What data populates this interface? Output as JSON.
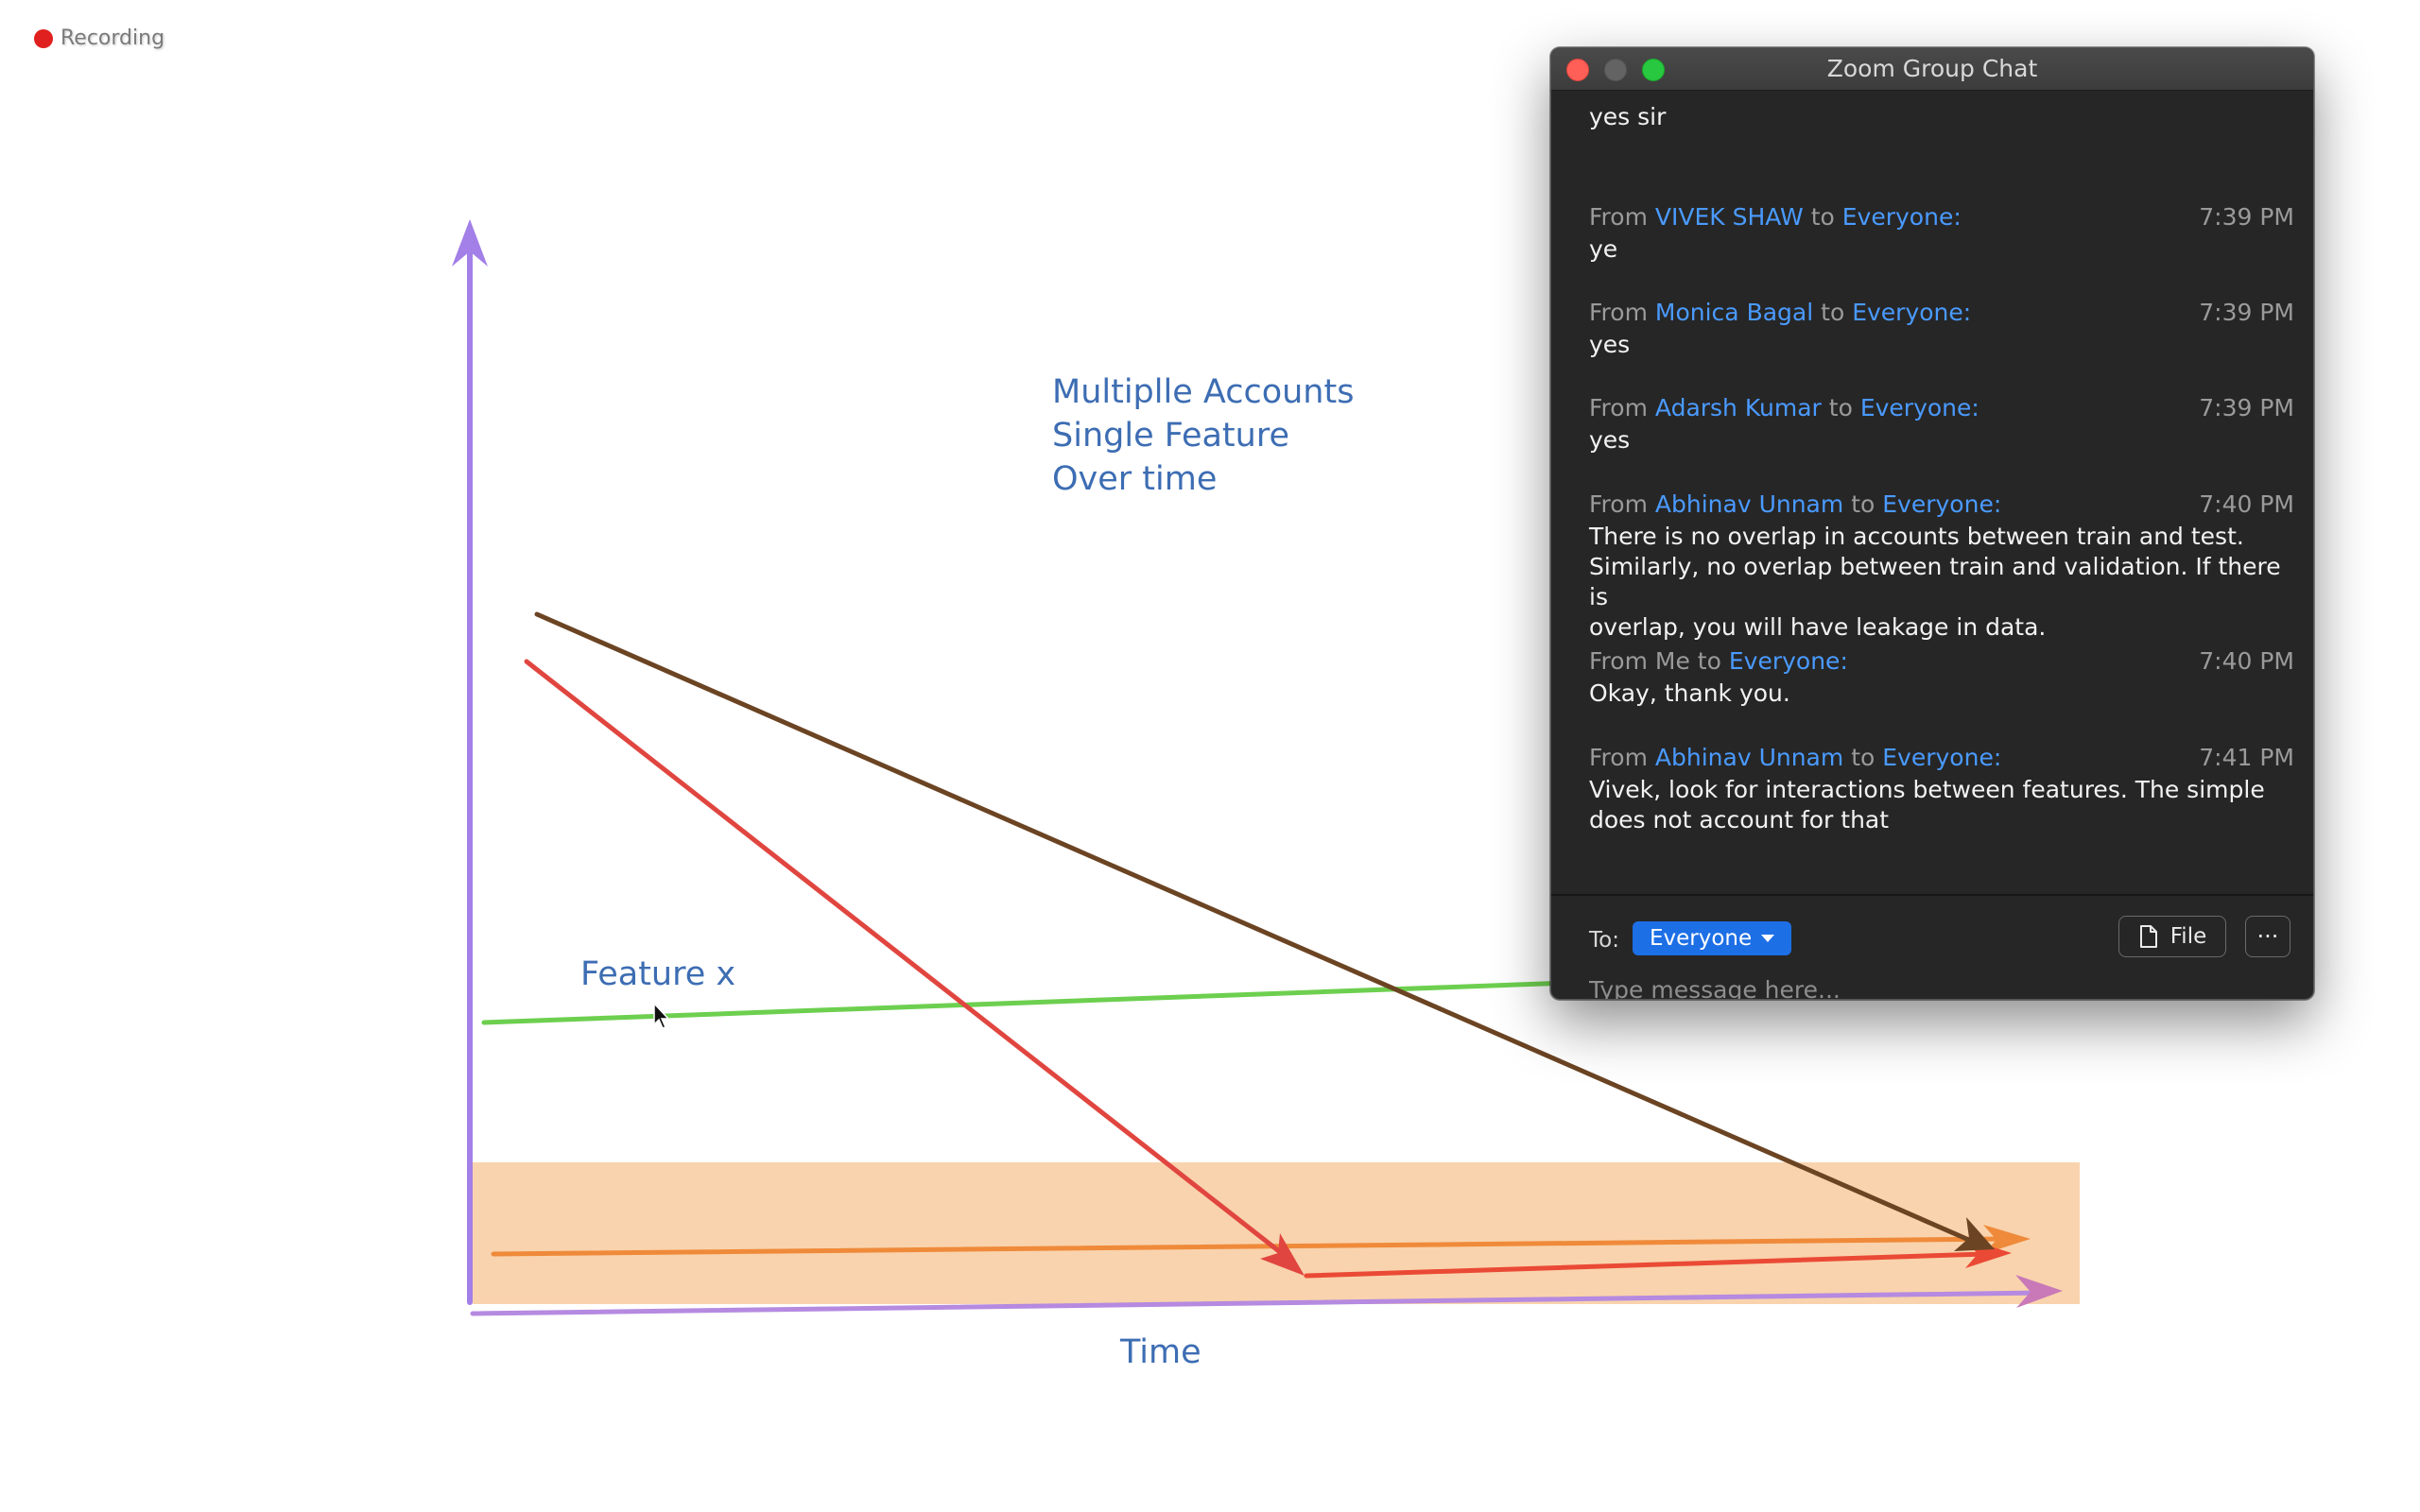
{
  "recording": {
    "label": "Recording"
  },
  "whiteboard": {
    "title_lines": [
      "Multiplle Accounts",
      "Single Feature",
      "Over time"
    ],
    "feature_label": "Feature x",
    "x_axis_label": "Time",
    "colors": {
      "axis": "#a37fe8",
      "band": "#f9d3ad",
      "green_line": "#6dcf4f",
      "brown_line": "#6b4423",
      "red_line": "#e0463f",
      "orange_line": "#ef8a3a",
      "text": "#3d6db3"
    }
  },
  "chat": {
    "title": "Zoom Group Chat",
    "partial_message": "yes sir",
    "messages": [
      {
        "from_prefix": "From",
        "sender": "VIVEK SHAW",
        "to_word": "to",
        "target": "Everyone",
        "colon": ":",
        "time": "7:39 PM",
        "lines": [
          "ye"
        ]
      },
      {
        "from_prefix": "From",
        "sender": "Monica Bagal",
        "to_word": "to",
        "target": "Everyone",
        "colon": ":",
        "time": "7:39 PM",
        "lines": [
          "yes"
        ]
      },
      {
        "from_prefix": "From",
        "sender": "Adarsh Kumar",
        "to_word": "to",
        "target": "Everyone",
        "colon": ":",
        "time": "7:39 PM",
        "lines": [
          "yes"
        ]
      },
      {
        "from_prefix": "From",
        "sender": "Abhinav Unnam",
        "to_word": "to",
        "target": "Everyone",
        "colon": ":",
        "time": "7:40 PM",
        "lines": [
          "There is no overlap in accounts between train and test.",
          "Similarly, no overlap between train and validation. If there is",
          "overlap, you will have leakage in data."
        ]
      },
      {
        "from_prefix": "From Me",
        "sender": "",
        "to_word": "to",
        "target": "Everyone",
        "colon": ":",
        "time": "7:40 PM",
        "lines": [
          "Okay, thank you."
        ]
      },
      {
        "from_prefix": "From",
        "sender": "Abhinav Unnam",
        "to_word": "to",
        "target": "Everyone",
        "colon": ":",
        "time": "7:41 PM",
        "lines": [
          "Vivek, look for interactions between features. The simple",
          "does not account for that"
        ]
      }
    ],
    "compose": {
      "to_label": "To:",
      "recipient": "Everyone",
      "file_label": "File",
      "more_label": "···",
      "placeholder": "Type message here..."
    },
    "colors": {
      "background": "#262626",
      "link": "#4a9aff",
      "select": "#1d6fe6"
    }
  }
}
